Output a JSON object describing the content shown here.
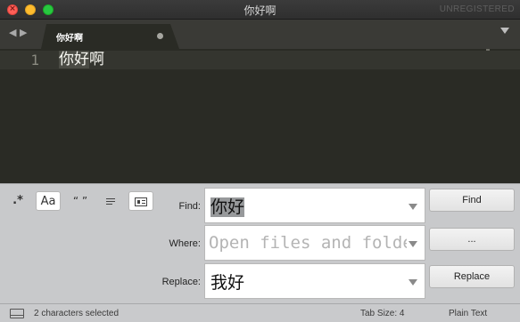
{
  "window": {
    "title": "你好啊",
    "registration": "UNREGISTERED"
  },
  "tabs": [
    {
      "label": "你好啊",
      "dirty": true
    }
  ],
  "editor": {
    "lines": [
      {
        "number": "1",
        "selected_text": "你好",
        "rest_text": "啊"
      }
    ]
  },
  "find_panel": {
    "options": {
      "regex": ".*",
      "case_sensitive": "Aa",
      "whole_word": "“ ”"
    },
    "find": {
      "label": "Find:",
      "value": "你好",
      "button": "Find"
    },
    "where": {
      "label": "Where:",
      "placeholder": "Open files and folders",
      "button": "..."
    },
    "replace": {
      "label": "Replace:",
      "value": "我好",
      "button": "Replace"
    }
  },
  "status_bar": {
    "selection": "2 characters selected",
    "tab_size": "Tab Size: 4",
    "syntax": "Plain Text"
  },
  "colors": {
    "editor_bg": "#2a2b25",
    "panel_bg": "#c8c9cb",
    "close": "#ff5f57",
    "minimize": "#febc2e",
    "maximize": "#28c840"
  },
  "icons": [
    "close-icon",
    "minimize-icon",
    "maximize-icon",
    "back-arrow-icon",
    "forward-arrow-icon",
    "tab-dirty-dot-icon",
    "tab-menu-icon",
    "wrap-icon",
    "in-selection-icon",
    "dropdown-caret-icon",
    "panel-toggle-icon"
  ]
}
